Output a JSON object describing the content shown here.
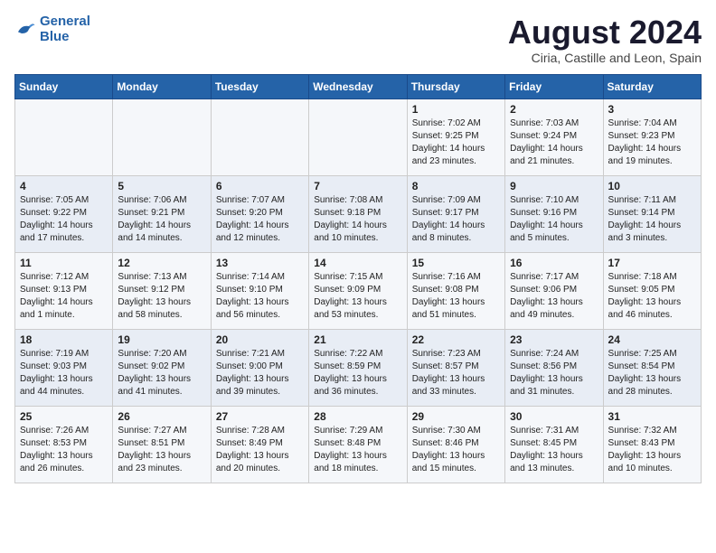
{
  "header": {
    "logo_line1": "General",
    "logo_line2": "Blue",
    "month": "August 2024",
    "location": "Ciria, Castille and Leon, Spain"
  },
  "days_of_week": [
    "Sunday",
    "Monday",
    "Tuesday",
    "Wednesday",
    "Thursday",
    "Friday",
    "Saturday"
  ],
  "weeks": [
    [
      {
        "day": "",
        "info": ""
      },
      {
        "day": "",
        "info": ""
      },
      {
        "day": "",
        "info": ""
      },
      {
        "day": "",
        "info": ""
      },
      {
        "day": "1",
        "info": "Sunrise: 7:02 AM\nSunset: 9:25 PM\nDaylight: 14 hours\nand 23 minutes."
      },
      {
        "day": "2",
        "info": "Sunrise: 7:03 AM\nSunset: 9:24 PM\nDaylight: 14 hours\nand 21 minutes."
      },
      {
        "day": "3",
        "info": "Sunrise: 7:04 AM\nSunset: 9:23 PM\nDaylight: 14 hours\nand 19 minutes."
      }
    ],
    [
      {
        "day": "4",
        "info": "Sunrise: 7:05 AM\nSunset: 9:22 PM\nDaylight: 14 hours\nand 17 minutes."
      },
      {
        "day": "5",
        "info": "Sunrise: 7:06 AM\nSunset: 9:21 PM\nDaylight: 14 hours\nand 14 minutes."
      },
      {
        "day": "6",
        "info": "Sunrise: 7:07 AM\nSunset: 9:20 PM\nDaylight: 14 hours\nand 12 minutes."
      },
      {
        "day": "7",
        "info": "Sunrise: 7:08 AM\nSunset: 9:18 PM\nDaylight: 14 hours\nand 10 minutes."
      },
      {
        "day": "8",
        "info": "Sunrise: 7:09 AM\nSunset: 9:17 PM\nDaylight: 14 hours\nand 8 minutes."
      },
      {
        "day": "9",
        "info": "Sunrise: 7:10 AM\nSunset: 9:16 PM\nDaylight: 14 hours\nand 5 minutes."
      },
      {
        "day": "10",
        "info": "Sunrise: 7:11 AM\nSunset: 9:14 PM\nDaylight: 14 hours\nand 3 minutes."
      }
    ],
    [
      {
        "day": "11",
        "info": "Sunrise: 7:12 AM\nSunset: 9:13 PM\nDaylight: 14 hours\nand 1 minute."
      },
      {
        "day": "12",
        "info": "Sunrise: 7:13 AM\nSunset: 9:12 PM\nDaylight: 13 hours\nand 58 minutes."
      },
      {
        "day": "13",
        "info": "Sunrise: 7:14 AM\nSunset: 9:10 PM\nDaylight: 13 hours\nand 56 minutes."
      },
      {
        "day": "14",
        "info": "Sunrise: 7:15 AM\nSunset: 9:09 PM\nDaylight: 13 hours\nand 53 minutes."
      },
      {
        "day": "15",
        "info": "Sunrise: 7:16 AM\nSunset: 9:08 PM\nDaylight: 13 hours\nand 51 minutes."
      },
      {
        "day": "16",
        "info": "Sunrise: 7:17 AM\nSunset: 9:06 PM\nDaylight: 13 hours\nand 49 minutes."
      },
      {
        "day": "17",
        "info": "Sunrise: 7:18 AM\nSunset: 9:05 PM\nDaylight: 13 hours\nand 46 minutes."
      }
    ],
    [
      {
        "day": "18",
        "info": "Sunrise: 7:19 AM\nSunset: 9:03 PM\nDaylight: 13 hours\nand 44 minutes."
      },
      {
        "day": "19",
        "info": "Sunrise: 7:20 AM\nSunset: 9:02 PM\nDaylight: 13 hours\nand 41 minutes."
      },
      {
        "day": "20",
        "info": "Sunrise: 7:21 AM\nSunset: 9:00 PM\nDaylight: 13 hours\nand 39 minutes."
      },
      {
        "day": "21",
        "info": "Sunrise: 7:22 AM\nSunset: 8:59 PM\nDaylight: 13 hours\nand 36 minutes."
      },
      {
        "day": "22",
        "info": "Sunrise: 7:23 AM\nSunset: 8:57 PM\nDaylight: 13 hours\nand 33 minutes."
      },
      {
        "day": "23",
        "info": "Sunrise: 7:24 AM\nSunset: 8:56 PM\nDaylight: 13 hours\nand 31 minutes."
      },
      {
        "day": "24",
        "info": "Sunrise: 7:25 AM\nSunset: 8:54 PM\nDaylight: 13 hours\nand 28 minutes."
      }
    ],
    [
      {
        "day": "25",
        "info": "Sunrise: 7:26 AM\nSunset: 8:53 PM\nDaylight: 13 hours\nand 26 minutes."
      },
      {
        "day": "26",
        "info": "Sunrise: 7:27 AM\nSunset: 8:51 PM\nDaylight: 13 hours\nand 23 minutes."
      },
      {
        "day": "27",
        "info": "Sunrise: 7:28 AM\nSunset: 8:49 PM\nDaylight: 13 hours\nand 20 minutes."
      },
      {
        "day": "28",
        "info": "Sunrise: 7:29 AM\nSunset: 8:48 PM\nDaylight: 13 hours\nand 18 minutes."
      },
      {
        "day": "29",
        "info": "Sunrise: 7:30 AM\nSunset: 8:46 PM\nDaylight: 13 hours\nand 15 minutes."
      },
      {
        "day": "30",
        "info": "Sunrise: 7:31 AM\nSunset: 8:45 PM\nDaylight: 13 hours\nand 13 minutes."
      },
      {
        "day": "31",
        "info": "Sunrise: 7:32 AM\nSunset: 8:43 PM\nDaylight: 13 hours\nand 10 minutes."
      }
    ]
  ]
}
